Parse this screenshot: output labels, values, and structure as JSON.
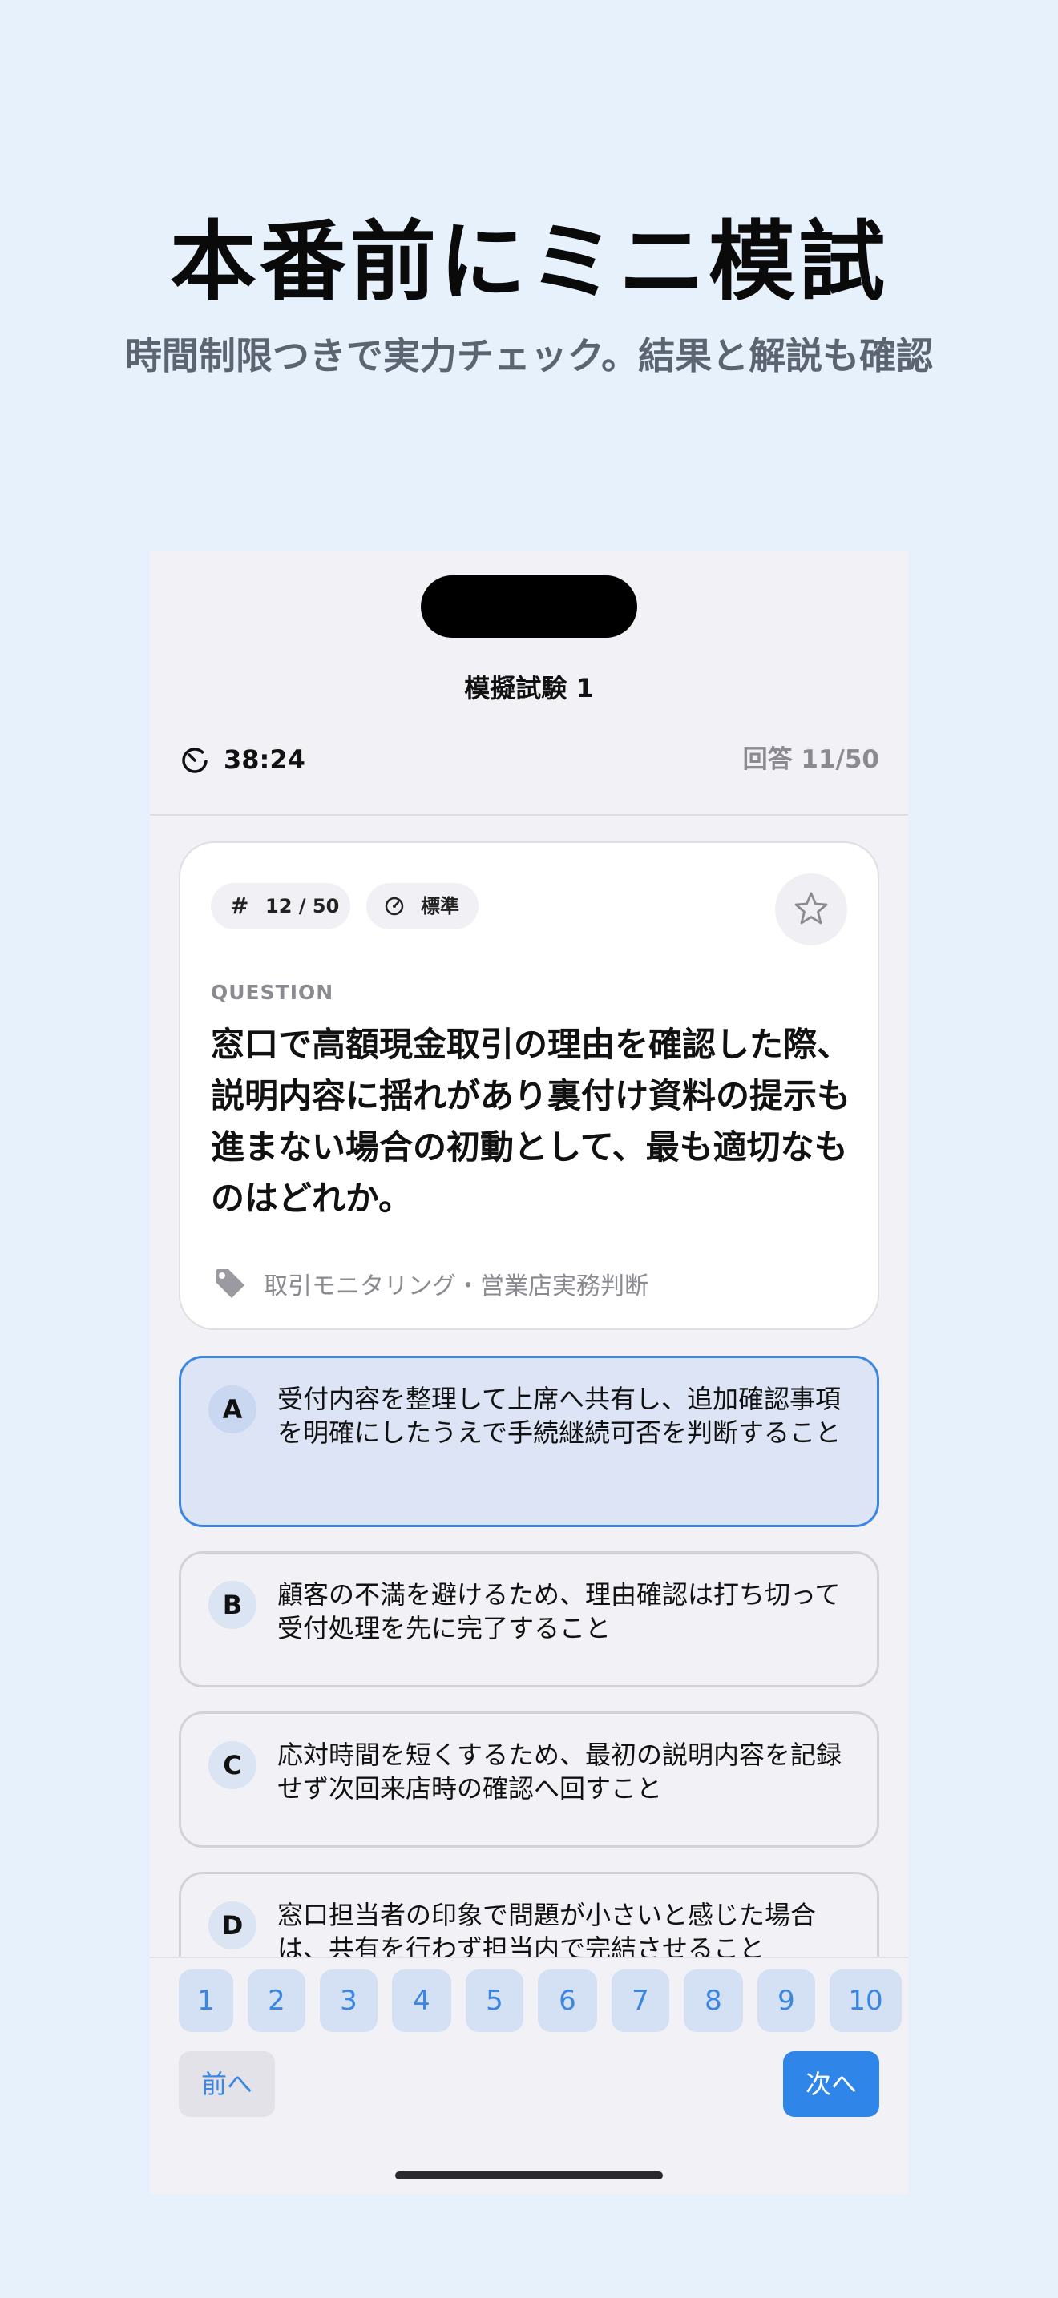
{
  "hero": {
    "title": "本番前にミニ模試",
    "subtitle": "時間制限つきで実力チェック。結果と解説も確認"
  },
  "app": {
    "nav_title": "模擬試験 1",
    "timer": "38:24",
    "answered": "回答 11/50",
    "question": {
      "number_badge": "12 / 50",
      "hash": "#",
      "level_badge": "標準",
      "label": "QUESTION",
      "text": "窓口で高額現金取引の理由を確認した際、説明内容に揺れがあり裏付け資料の提示も進まない場合の初動として、最も適切なものはどれか。",
      "tag": "取引モニタリング・営業店実務判断"
    },
    "options": [
      {
        "letter": "A",
        "text": "受付内容を整理して上席へ共有し、追加確認事項を明確にしたうえで手続継続可否を判断すること",
        "selected": true
      },
      {
        "letter": "B",
        "text": "顧客の不満を避けるため、理由確認は打ち切って受付処理を先に完了すること",
        "selected": false
      },
      {
        "letter": "C",
        "text": "応対時間を短くするため、最初の説明内容を記録せず次回来店時の確認へ回すこと",
        "selected": false
      },
      {
        "letter": "D",
        "text": "窓口担当者の印象で問題が小さいと感じた場合は、共有を行わず担当内で完結させること",
        "selected": false
      }
    ],
    "question_nav": [
      "1",
      "2",
      "3",
      "4",
      "5",
      "6",
      "7",
      "8",
      "9",
      "10"
    ],
    "prev_label": "前へ",
    "next_label": "次へ"
  },
  "colors": {
    "accent": "#2f86e8",
    "background": "#e6f1fc",
    "selected_option": "#dce4f5"
  }
}
